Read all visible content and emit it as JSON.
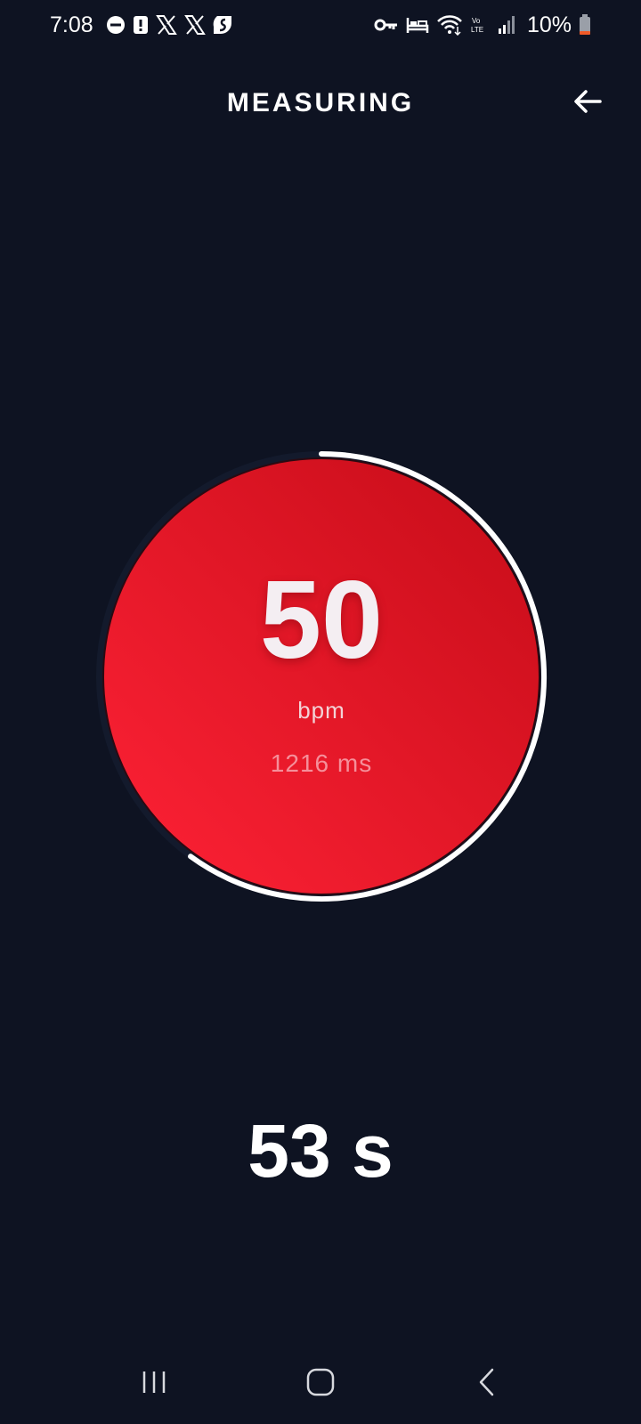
{
  "status_bar": {
    "time": "7:08",
    "battery_percent": "10%",
    "left_icons": [
      "do-not-disturb-icon",
      "alert-icon",
      "x-app-icon",
      "x-app-icon",
      "shortcut-app-icon"
    ],
    "right_icons": [
      "vpn-key-icon",
      "sleep-mode-icon",
      "wifi-icon",
      "volte-icon",
      "signal-icon",
      "battery-icon"
    ],
    "volte_label": "Vo LTE"
  },
  "header": {
    "title": "MEASURING",
    "back_icon": "arrow-left-icon"
  },
  "gauge": {
    "bpm": "50",
    "unit": "bpm",
    "interval": "1216 ms",
    "progress_fraction": 0.6,
    "colors": {
      "fill_light": "#ff2236",
      "fill_dark": "#c50c18",
      "progress": "#ffffff"
    }
  },
  "timer": {
    "remaining": "53 s"
  },
  "nav_bar": {
    "icons": [
      "recent-apps-icon",
      "home-icon",
      "back-icon"
    ]
  },
  "colors": {
    "background": "#0e1322",
    "text": "#ffffff"
  }
}
